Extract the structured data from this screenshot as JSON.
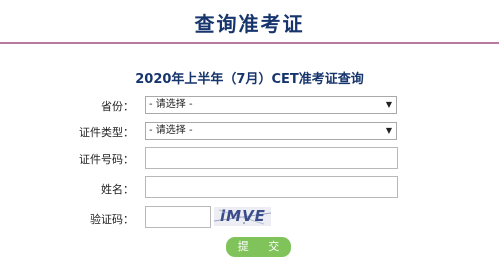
{
  "page": {
    "title": "查询准考证"
  },
  "form": {
    "heading": "2020年上半年（7月）CET准考证查询",
    "province": {
      "label": "省份：",
      "selected": "- 请选择 -"
    },
    "id_type": {
      "label": "证件类型：",
      "selected": "- 请选择 -"
    },
    "id_number": {
      "label": "证件号码：",
      "value": ""
    },
    "name": {
      "label": "姓名：",
      "value": ""
    },
    "captcha": {
      "label": "验证码：",
      "value": "",
      "image_text": "iMVE"
    },
    "submit_label": "提 交"
  },
  "colors": {
    "title": "#17356d",
    "rule": "#b87aa0",
    "button": "#7fc35a"
  }
}
